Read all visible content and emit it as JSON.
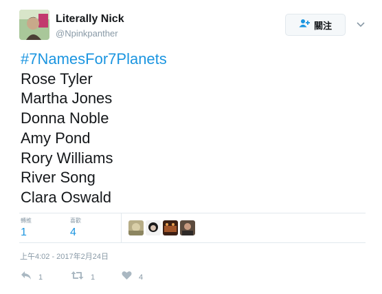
{
  "user": {
    "display_name": "Literally Nick",
    "username": "@Npinkpanther"
  },
  "follow_button": {
    "label": "關注"
  },
  "tweet": {
    "hashtag": "#7NamesFor7Planets",
    "lines": [
      "Rose Tyler",
      "Martha Jones",
      "Donna Noble",
      "Amy Pond",
      "Rory Williams",
      "River Song",
      "Clara Oswald"
    ]
  },
  "stats": {
    "retweets_label": "轉推",
    "retweets_value": "1",
    "likes_label": "喜歡",
    "likes_value": "4"
  },
  "timestamp": "上午4:02 - 2017年2月24日",
  "actions": {
    "reply_count": "1",
    "retweet_count": "1",
    "like_count": "4"
  },
  "colors": {
    "link_blue": "#1b95e0",
    "muted_gray": "#8899a6",
    "border": "#e1e8ed"
  },
  "icons": [
    "follow-user-icon",
    "chevron-down-icon",
    "reply-icon",
    "retweet-icon",
    "heart-icon"
  ]
}
